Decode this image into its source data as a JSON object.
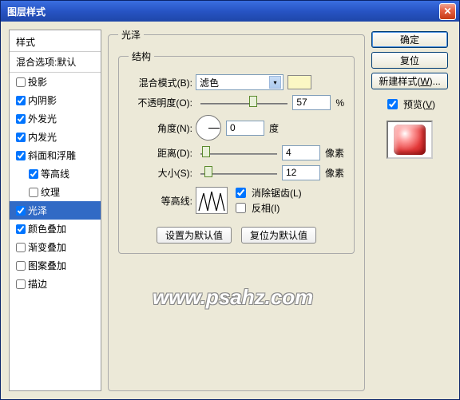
{
  "title": "图层样式",
  "left": {
    "header": "样式",
    "sub": "混合选项:默认",
    "items": [
      {
        "label": "投影",
        "checked": false,
        "indent": false
      },
      {
        "label": "内阴影",
        "checked": true,
        "indent": false
      },
      {
        "label": "外发光",
        "checked": true,
        "indent": false
      },
      {
        "label": "内发光",
        "checked": true,
        "indent": false
      },
      {
        "label": "斜面和浮雕",
        "checked": true,
        "indent": false
      },
      {
        "label": "等高线",
        "checked": true,
        "indent": true
      },
      {
        "label": "纹理",
        "checked": false,
        "indent": true
      },
      {
        "label": "光泽",
        "checked": true,
        "indent": false,
        "selected": true
      },
      {
        "label": "颜色叠加",
        "checked": true,
        "indent": false
      },
      {
        "label": "渐变叠加",
        "checked": false,
        "indent": false
      },
      {
        "label": "图案叠加",
        "checked": false,
        "indent": false
      },
      {
        "label": "描边",
        "checked": false,
        "indent": false
      }
    ]
  },
  "center": {
    "outer_legend": "光泽",
    "inner_legend": "结构",
    "blend_label": "混合模式(B):",
    "blend_value": "滤色",
    "swatch_color": "#fbf7c4",
    "opacity_label": "不透明度(O):",
    "opacity_value": "57",
    "opacity_unit": "%",
    "angle_label": "角度(N):",
    "angle_value": "0",
    "angle_unit": "度",
    "distance_label": "距离(D):",
    "distance_value": "4",
    "distance_unit": "像素",
    "size_label": "大小(S):",
    "size_value": "12",
    "size_unit": "像素",
    "contour_label": "等高线:",
    "antialias_label": "消除锯齿(L)",
    "invert_label": "反相(I)",
    "btn_default": "设置为默认值",
    "btn_reset": "复位为默认值"
  },
  "right": {
    "ok": "确定",
    "cancel": "复位",
    "newstyle": "新建样式(W)...",
    "preview": "预览(V)"
  },
  "watermark": "www.psahz.com"
}
